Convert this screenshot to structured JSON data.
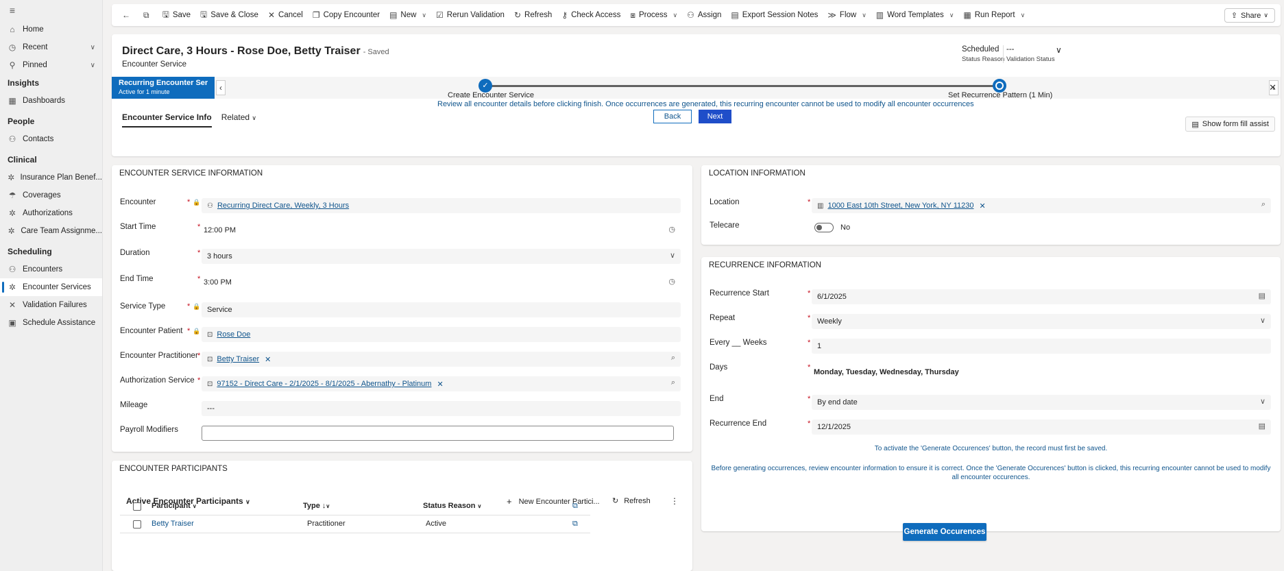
{
  "sidebar": {
    "menu_icon": "hamburger-icon",
    "items_top": [
      {
        "label": "Home",
        "icon": "home-icon"
      },
      {
        "label": "Recent",
        "icon": "clock-icon"
      },
      {
        "label": "Pinned",
        "icon": "pin-icon"
      }
    ],
    "groups": [
      {
        "title": "Insights",
        "items": [
          {
            "label": "Dashboards"
          }
        ]
      },
      {
        "title": "People",
        "items": [
          {
            "label": "Contacts"
          }
        ]
      },
      {
        "title": "Clinical",
        "items": [
          {
            "label": "Insurance Plan Benef..."
          },
          {
            "label": "Coverages"
          },
          {
            "label": "Authorizations"
          },
          {
            "label": "Care Team Assignme..."
          }
        ]
      },
      {
        "title": "Scheduling",
        "items": [
          {
            "label": "Encounters"
          },
          {
            "label": "Encounter Services"
          },
          {
            "label": "Validation Failures"
          },
          {
            "label": "Schedule Assistance"
          }
        ]
      }
    ]
  },
  "commandbar": {
    "save": "Save",
    "save_close": "Save & Close",
    "cancel": "Cancel",
    "copy": "Copy Encounter",
    "new": "New",
    "rerun": "Rerun Validation",
    "refresh": "Refresh",
    "check_access": "Check Access",
    "process": "Process",
    "assign": "Assign",
    "export": "Export Session Notes",
    "flow": "Flow",
    "word_templates": "Word Templates",
    "run_report": "Run Report",
    "share": "Share"
  },
  "header": {
    "title": "Direct Care, 3 Hours - Rose Doe, Betty Traiser",
    "saved": "- Saved",
    "entity": "Encounter Service",
    "status_reason_value": "Scheduled",
    "status_reason_label": "Status Reason",
    "validation_value": "---",
    "validation_label": "Validation Status"
  },
  "bpf": {
    "active_name": "Recurring Encounter Ser...",
    "active_sub": "Active for 1 minute",
    "stage1": "Create Encounter Service",
    "stage2": "Set Recurrence Pattern  (1 Min)",
    "notice": "Review all encounter details before clicking finish. Once occurrences are generated, this recurring encounter cannot be used to modify all encounter occurrences",
    "back": "Back",
    "next": "Next"
  },
  "tabs": {
    "info": "Encounter Service Info",
    "related": "Related",
    "form_fill": "Show form fill assist"
  },
  "service_info": {
    "title": "ENCOUNTER SERVICE INFORMATION",
    "encounter_label": "Encounter",
    "encounter_value": "Recurring Direct Care, Weekly, 3 Hours",
    "start_label": "Start Time",
    "start_value": "12:00 PM",
    "duration_label": "Duration",
    "duration_value": "3 hours",
    "end_label": "End Time",
    "end_value": "3:00 PM",
    "service_type_label": "Service Type",
    "service_type_value": "Service",
    "patient_label": "Encounter Patient",
    "patient_value": "Rose Doe",
    "practitioner_label": "Encounter Practitioner",
    "practitioner_value": "Betty Traiser",
    "auth_label": "Authorization Service",
    "auth_value": "97152 - Direct Care - 2/1/2025 - 8/1/2025 - Abernathy - Platinum",
    "mileage_label": "Mileage",
    "mileage_value": "---",
    "payroll_label": "Payroll Modifiers",
    "payroll_value": ""
  },
  "location": {
    "title": "LOCATION INFORMATION",
    "location_label": "Location",
    "location_value": "1000 East 10th Street, New York, NY 11230",
    "telecare_label": "Telecare",
    "telecare_value": "No"
  },
  "recurrence": {
    "title": "RECURRENCE INFORMATION",
    "start_label": "Recurrence Start",
    "start_value": "6/1/2025",
    "repeat_label": "Repeat",
    "repeat_value": "Weekly",
    "every_label": "Every __ Weeks",
    "every_value": "1",
    "days_label": "Days",
    "days_value": "Monday, Tuesday, Wednesday, Thursday",
    "end_label": "End",
    "end_value": "By end date",
    "rend_label": "Recurrence End",
    "rend_value": "12/1/2025",
    "info1": "To activate the 'Generate Occurences' button, the record must first be saved.",
    "info2": "Before generating occurrences, review encounter information to ensure it is correct. Once the 'Generate Occurences' button is clicked, this recurring encounter cannot be used to modify all encounter occurences.",
    "generate": "Generate Occurences"
  },
  "participants": {
    "title": "ENCOUNTER PARTICIPANTS",
    "view": "Active Encounter Participants",
    "new": "New Encounter Partici...",
    "refresh": "Refresh",
    "col_participant": "Participant",
    "col_type": "Type",
    "col_status": "Status Reason",
    "rows": [
      {
        "participant": "Betty Traiser",
        "type": "Practitioner",
        "status": "Active"
      }
    ]
  }
}
